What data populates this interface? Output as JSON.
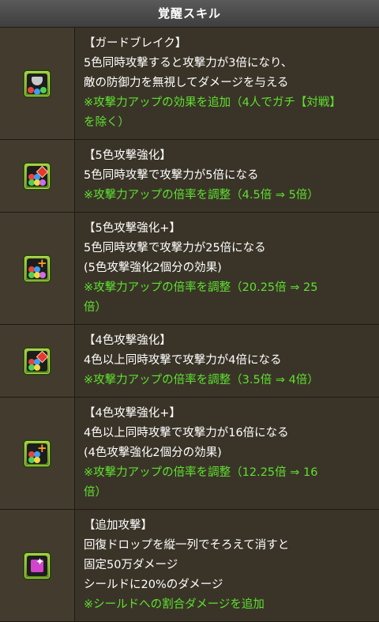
{
  "header": {
    "title": "覚醒スキル"
  },
  "skills": [
    {
      "icon": "guard-break-icon",
      "lines": [
        {
          "text": "【ガードブレイク】",
          "green": false
        },
        {
          "text": "5色同時攻撃すると攻撃力が3倍になり、",
          "green": false
        },
        {
          "text": "敵の防御力を無視してダメージを与える",
          "green": false
        },
        {
          "text": "※攻撃力アップの効果を追加（4人でガチ【対戦】",
          "green": true
        },
        {
          "text": "を除く）",
          "green": true
        }
      ]
    },
    {
      "icon": "five-color-attack-boost-icon",
      "lines": [
        {
          "text": "【5色攻撃強化】",
          "green": false
        },
        {
          "text": "5色同時攻撃で攻撃力が5倍になる",
          "green": false
        },
        {
          "text": "※攻撃力アップの倍率を調整（4.5倍 ⇒ 5倍）",
          "green": true
        }
      ]
    },
    {
      "icon": "five-color-attack-boost-plus-icon",
      "lines": [
        {
          "text": "【5色攻撃強化+】",
          "green": false
        },
        {
          "text": "5色同時攻撃で攻撃力が25倍になる",
          "green": false
        },
        {
          "text": "(5色攻撃強化2個分の効果)",
          "green": false
        },
        {
          "text": "※攻撃力アップの倍率を調整（20.25倍 ⇒ 25",
          "green": true
        },
        {
          "text": "倍）",
          "green": true
        }
      ]
    },
    {
      "icon": "four-color-attack-boost-icon",
      "lines": [
        {
          "text": "【4色攻撃強化】",
          "green": false
        },
        {
          "text": "4色以上同時攻撃で攻撃力が4倍になる",
          "green": false
        },
        {
          "text": "※攻撃力アップの倍率を調整（3.5倍 ⇒ 4倍）",
          "green": true
        }
      ]
    },
    {
      "icon": "four-color-attack-boost-plus-icon",
      "lines": [
        {
          "text": "【4色攻撃強化+】",
          "green": false
        },
        {
          "text": "4色以上同時攻撃で攻撃力が16倍になる",
          "green": false
        },
        {
          "text": "(4色攻撃強化2個分の効果)",
          "green": false
        },
        {
          "text": "※攻撃力アップの倍率を調整（12.25倍 ⇒ 16",
          "green": true
        },
        {
          "text": "倍）",
          "green": true
        }
      ]
    },
    {
      "icon": "additional-attack-icon",
      "lines": [
        {
          "text": "【追加攻撃】",
          "green": false
        },
        {
          "text": "回復ドロップを縦一列でそろえて消すと",
          "green": false
        },
        {
          "text": "固定50万ダメージ",
          "green": false
        },
        {
          "text": "シールドに20%のダメージ",
          "green": false
        },
        {
          "text": "※シールドへの割合ダメージを追加",
          "green": true
        }
      ]
    }
  ]
}
